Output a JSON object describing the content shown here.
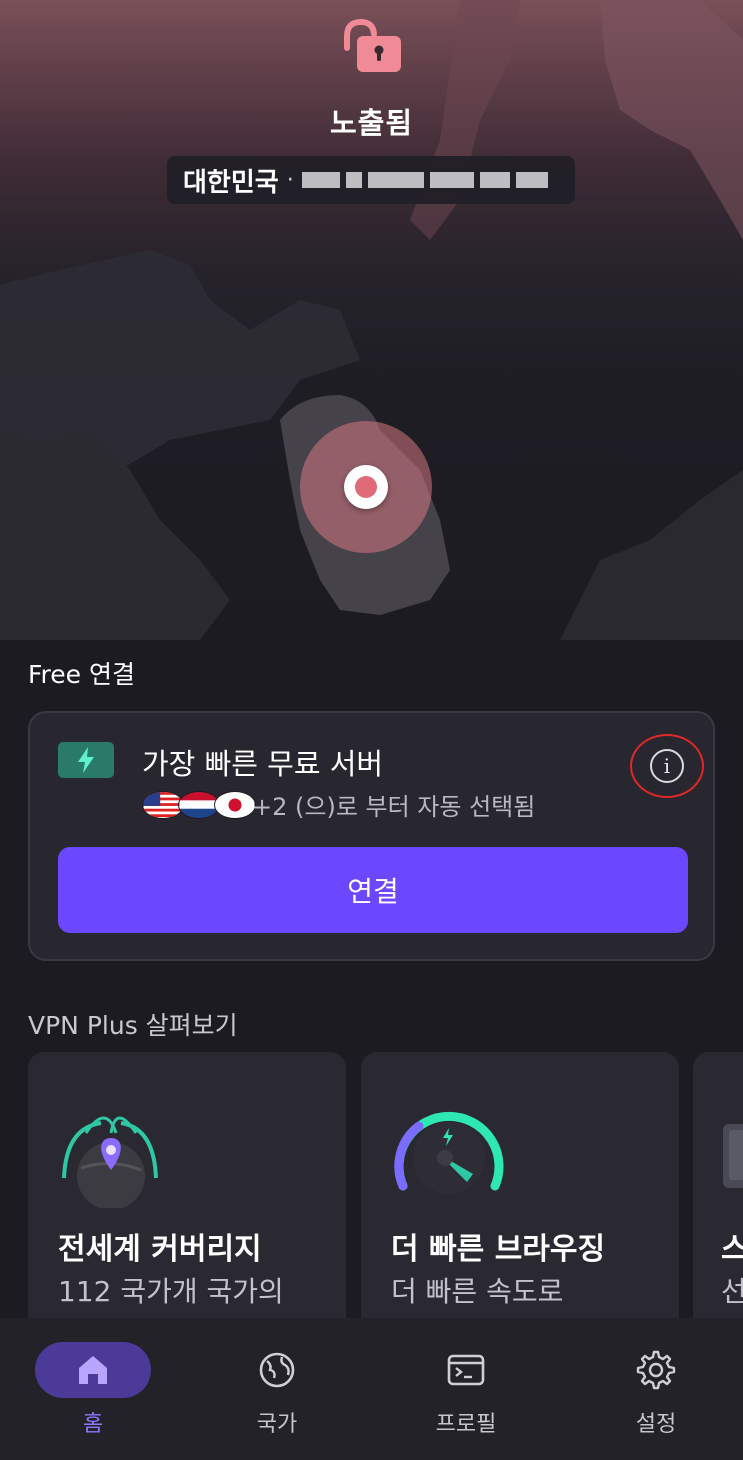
{
  "status": {
    "title": "노출됨",
    "icon": "unlocked-padlock-icon",
    "location_country": "대한민국",
    "separator": "·"
  },
  "free_section": {
    "label": "Free 연결",
    "server_title": "가장 빠른 무료 서버",
    "server_subtitle": "+2 (으)로 부터 자동 선택됨",
    "flags": [
      "us-flag-icon",
      "nl-flag-icon",
      "jp-flag-icon"
    ],
    "connect_label": "연결"
  },
  "plus_section": {
    "label": "VPN Plus 살펴보기",
    "cards": [
      {
        "title": "전세계 커버리지",
        "desc": "112 국가개 국가의",
        "icon": "globe-coverage-icon"
      },
      {
        "title": "더 빠른 브라우징",
        "desc": "더 빠른 속도로",
        "icon": "speedometer-icon"
      },
      {
        "title": "스",
        "desc": "선",
        "icon": "device-icon"
      }
    ]
  },
  "nav": [
    {
      "label": "홈",
      "icon": "home-icon",
      "active": true
    },
    {
      "label": "국가",
      "icon": "globe-icon",
      "active": false
    },
    {
      "label": "프로필",
      "icon": "terminal-icon",
      "active": false
    },
    {
      "label": "설정",
      "icon": "gear-icon",
      "active": false
    }
  ],
  "colors": {
    "accent": "#6b48ff",
    "danger_pin": "#e06a78",
    "lock": "#f08a96",
    "badge": "#2a7a6a",
    "highlight_ring": "#e02828"
  }
}
